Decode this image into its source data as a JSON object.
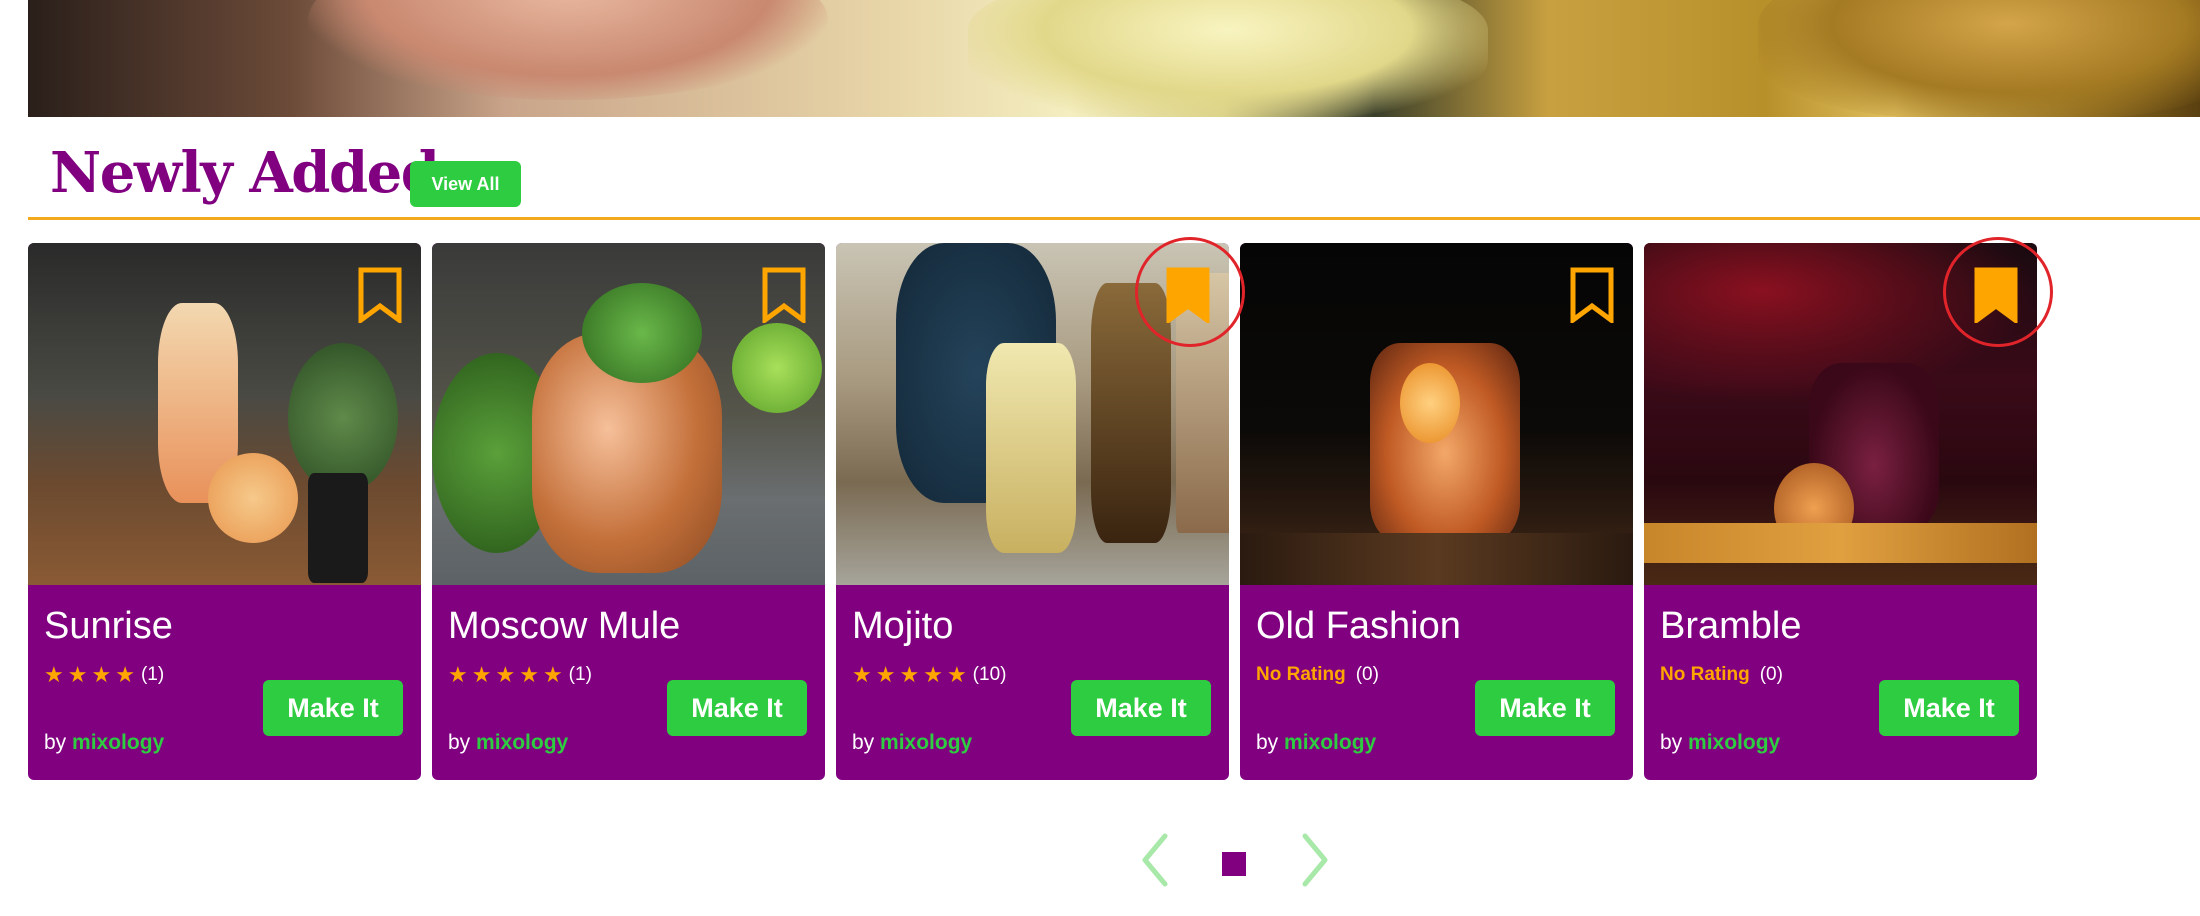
{
  "section": {
    "title": "Newly Added",
    "view_all_label": "View All"
  },
  "cards": [
    {
      "name": "Sunrise",
      "stars": 4,
      "rating_text": "",
      "count": "(1)",
      "button": "Make It",
      "by": "by",
      "author": "mixology",
      "bookmarked": false
    },
    {
      "name": "Moscow Mule",
      "stars": 5,
      "rating_text": "",
      "count": "(1)",
      "button": "Make It",
      "by": "by",
      "author": "mixology",
      "bookmarked": false
    },
    {
      "name": "Mojito",
      "stars": 5,
      "rating_text": "",
      "count": "(10)",
      "button": "Make It",
      "by": "by",
      "author": "mixology",
      "bookmarked": true
    },
    {
      "name": "Old Fashion",
      "stars": 0,
      "rating_text": "No Rating",
      "count": "(0)",
      "button": "Make It",
      "by": "by",
      "author": "mixology",
      "bookmarked": false
    },
    {
      "name": "Bramble",
      "stars": 0,
      "rating_text": "No Rating",
      "count": "(0)",
      "button": "Make It",
      "by": "by",
      "author": "mixology",
      "bookmarked": true
    }
  ],
  "colors": {
    "brand_purple": "#800080",
    "accent_green": "#2ecc40",
    "accent_orange": "#ffa500",
    "divider_orange": "#f2a91d",
    "highlight_red": "#e0242a"
  },
  "icons": {
    "bookmark": "bookmark-icon",
    "star": "star-icon",
    "prev": "chevron-left-icon",
    "next": "chevron-right-icon"
  },
  "pagination": {
    "current_page": 1,
    "total_pages": 1
  }
}
